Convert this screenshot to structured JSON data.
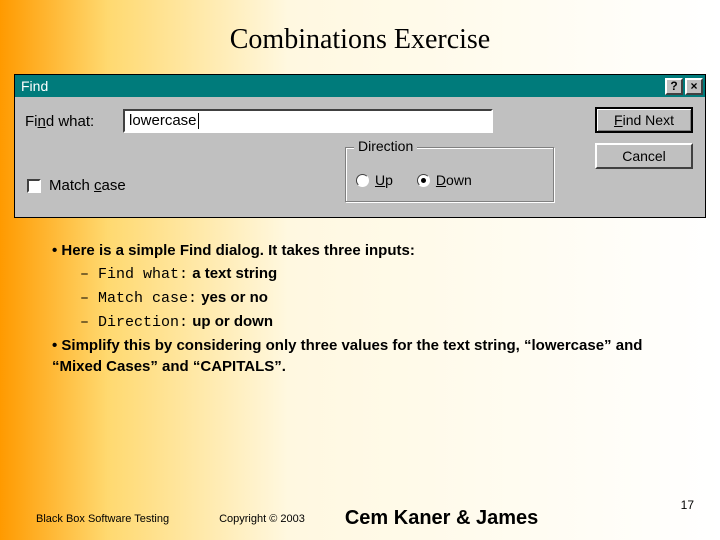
{
  "slide": {
    "title": "Combinations Exercise",
    "page_number": "17"
  },
  "dialog": {
    "title": "Find",
    "help_btn": "?",
    "close_btn": "×",
    "find_what_label_prefix": "Fi",
    "find_what_label_ul": "n",
    "find_what_label_suffix": "d what:",
    "find_value": "lowercase",
    "find_next_ul": "F",
    "find_next_rest": "ind Next",
    "cancel": "Cancel",
    "match_case_prefix": "Match ",
    "match_case_ul": "c",
    "match_case_suffix": "ase",
    "direction_legend": "Direction",
    "up_ul": "U",
    "up_rest": "p",
    "down_ul": "D",
    "down_rest": "own"
  },
  "notes": {
    "b1": "• Here is a simple Find dialog. It takes three inputs:",
    "s1_key": "Find what:",
    "s1_desc": " a text string",
    "s2_key": "Match case:",
    "s2_desc": "  yes or no",
    "s3_key": "Direction:",
    "s3_desc": "  up or down",
    "b2": "• Simplify this by considering only three values for the text string, “lowercase” and “Mixed Cases” and “CAPITALS”."
  },
  "footer": {
    "left": "Black Box Software Testing",
    "copy": "Copyright ©  2003",
    "authors": "Cem Kaner & James"
  }
}
